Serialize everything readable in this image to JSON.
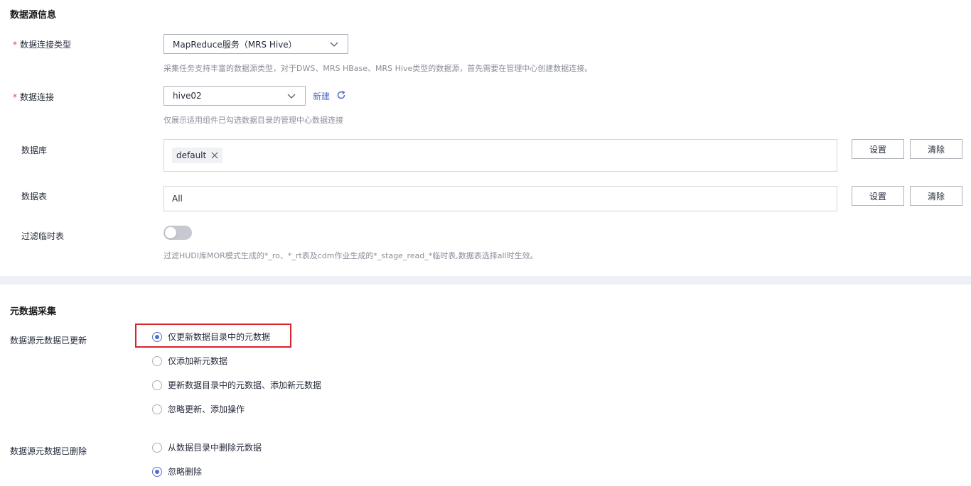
{
  "datasource": {
    "section_title": "数据源信息",
    "conn_type": {
      "label": "数据连接类型",
      "required_mark": "*",
      "value": "MapReduce服务（MRS Hive）",
      "hint": "采集任务支持丰富的数据源类型，对于DWS、MRS HBase、MRS Hive类型的数据源，首先需要在管理中心创建数据连接。"
    },
    "connection": {
      "label": "数据连接",
      "required_mark": "*",
      "value": "hive02",
      "new_link": "新建",
      "hint": "仅展示适用组件已勾选数据目录的管理中心数据连接"
    },
    "database": {
      "label": "数据库",
      "tag": "default",
      "set_label": "设置",
      "clear_label": "清除"
    },
    "table": {
      "label": "数据表",
      "value": "All",
      "set_label": "设置",
      "clear_label": "清除"
    },
    "filter_temp": {
      "label": "过滤临时表",
      "enabled": false,
      "hint": "过滤HUDI库MOR模式生成的*_ro、*_rt表及cdm作业生成的*_stage_read_*临时表,数据表选择all时生效。"
    }
  },
  "metadata": {
    "section_title": "元数据采集",
    "updated": {
      "label": "数据源元数据已更新",
      "options": [
        {
          "label": "仅更新数据目录中的元数据",
          "checked": true
        },
        {
          "label": "仅添加新元数据",
          "checked": false
        },
        {
          "label": "更新数据目录中的元数据、添加新元数据",
          "checked": false
        },
        {
          "label": "忽略更新、添加操作",
          "checked": false
        }
      ]
    },
    "deleted": {
      "label": "数据源元数据已删除",
      "options": [
        {
          "label": "从数据目录中删除元数据",
          "checked": false
        },
        {
          "label": "忽略删除",
          "checked": true
        }
      ]
    }
  },
  "colors": {
    "accent": "#526ecc",
    "required": "#e54545",
    "highlight": "#d7232c"
  }
}
